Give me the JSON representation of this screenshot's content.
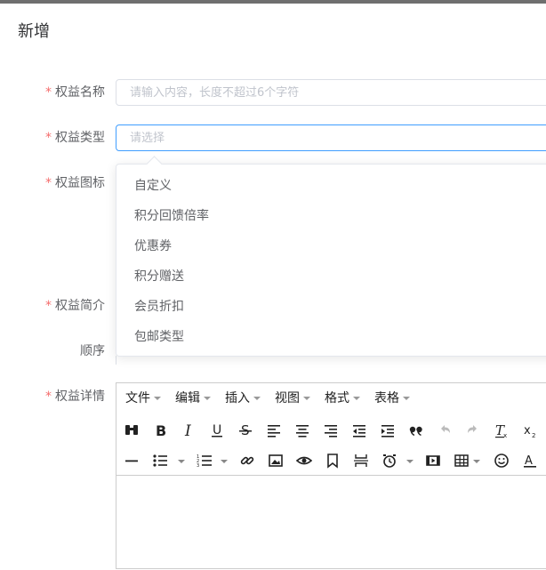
{
  "dialog": {
    "title": "新增"
  },
  "form": {
    "required_mark": "*",
    "name": {
      "label": "权益名称",
      "placeholder": "请输入内容，长度不超过6个字符"
    },
    "type": {
      "label": "权益类型",
      "placeholder": "请选择"
    },
    "icon": {
      "label": "权益图标"
    },
    "intro": {
      "label": "权益简介"
    },
    "order": {
      "label": "顺序"
    },
    "detail": {
      "label": "权益详情"
    }
  },
  "type_options": [
    "自定义",
    "积分回馈倍率",
    "优惠券",
    "积分赠送",
    "会员折扣",
    "包邮类型"
  ],
  "editor": {
    "menus": [
      "文件",
      "编辑",
      "插入",
      "视图",
      "格式",
      "表格"
    ]
  },
  "colors": {
    "focus": "#409eff",
    "required": "#f56c6c"
  }
}
